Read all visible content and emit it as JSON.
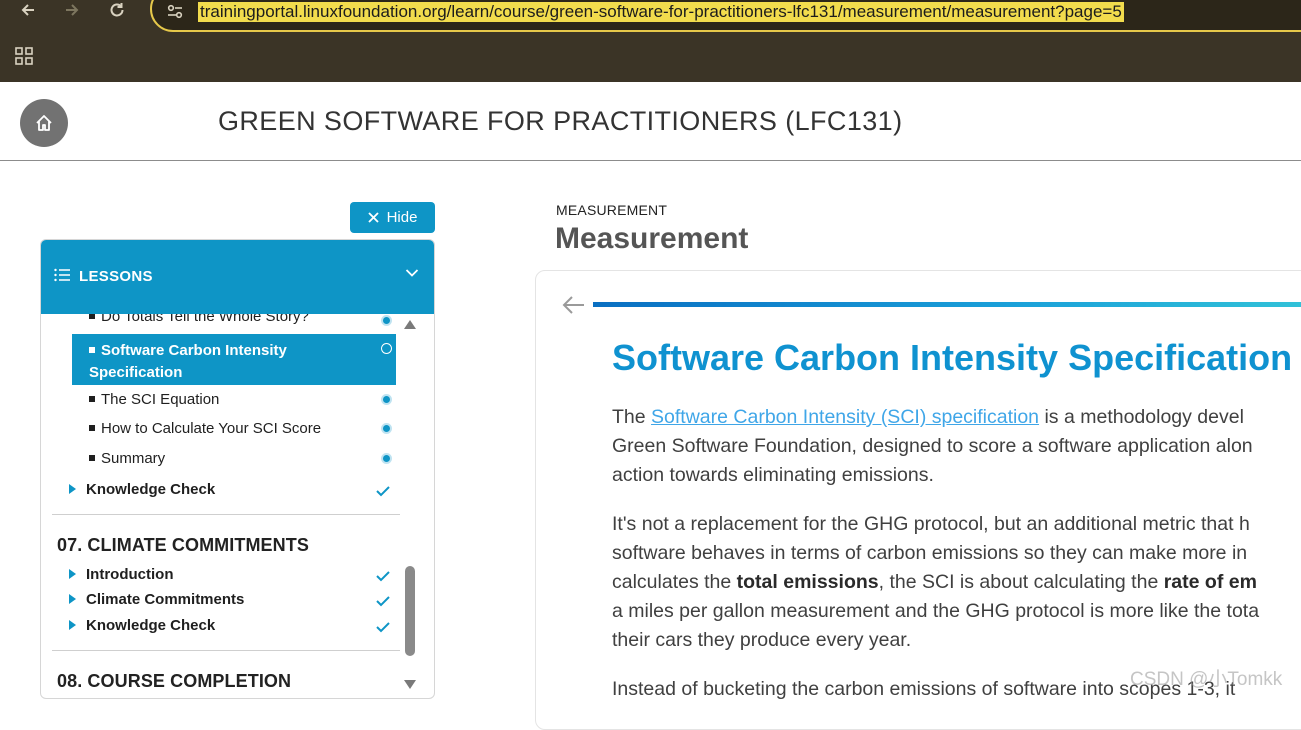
{
  "browser": {
    "url": "trainingportal.linuxfoundation.org/learn/course/green-software-for-practitioners-lfc131/measurement/measurement?page=5"
  },
  "header": {
    "course_title": "GREEN SOFTWARE FOR PRACTITIONERS (LFC131)"
  },
  "sidebar": {
    "hide_label": "Hide",
    "lessons_label": "LESSONS",
    "items": [
      {
        "label": "Do Totals Tell the Whole Story?",
        "status": "done"
      },
      {
        "label": "Software Carbon Intensity Specification",
        "status": "current"
      },
      {
        "label": "The SCI Equation",
        "status": "done"
      },
      {
        "label": "How to Calculate Your SCI Score",
        "status": "done"
      },
      {
        "label": "Summary",
        "status": "done"
      }
    ],
    "knowledge_check": "Knowledge Check",
    "section7": {
      "title": "07. CLIMATE COMMITMENTS",
      "topics": [
        "Introduction",
        "Climate Commitments",
        "Knowledge Check"
      ]
    },
    "section8": {
      "title": "08. COURSE COMPLETION"
    }
  },
  "main": {
    "breadcrumb": "MEASUREMENT",
    "heading": "Measurement",
    "article_title": "Software Carbon Intensity Specification",
    "p1": {
      "pre": "The ",
      "link": "Software Carbon Intensity (SCI) specification",
      "post": " is a methodology devel",
      "l2": "Green Software Foundation, designed to score a software application alon",
      "l3": "action towards eliminating emissions."
    },
    "p2": {
      "l1": "It's not a replacement for the GHG protocol, but an additional metric that h",
      "l2": "software behaves in terms of carbon emissions so they can make more in",
      "l3_pre": "calculates the ",
      "l3_b1": "total emissions",
      "l3_mid": ", the SCI is about calculating the ",
      "l3_b2": "rate of em",
      "l4": "a miles per gallon measurement and the GHG protocol is more like the tota",
      "l5": "their cars they produce every year."
    },
    "p3": {
      "l1": "Instead of bucketing the carbon emissions of software into scopes 1-3, it"
    }
  },
  "watermark": "CSDN @小Tomkk",
  "colors": {
    "accent": "#0e95c6",
    "title_blue": "#0f92d0",
    "link": "#3fa6e8",
    "chrome": "#3b3426",
    "url_highlight": "#f2dc4d"
  }
}
